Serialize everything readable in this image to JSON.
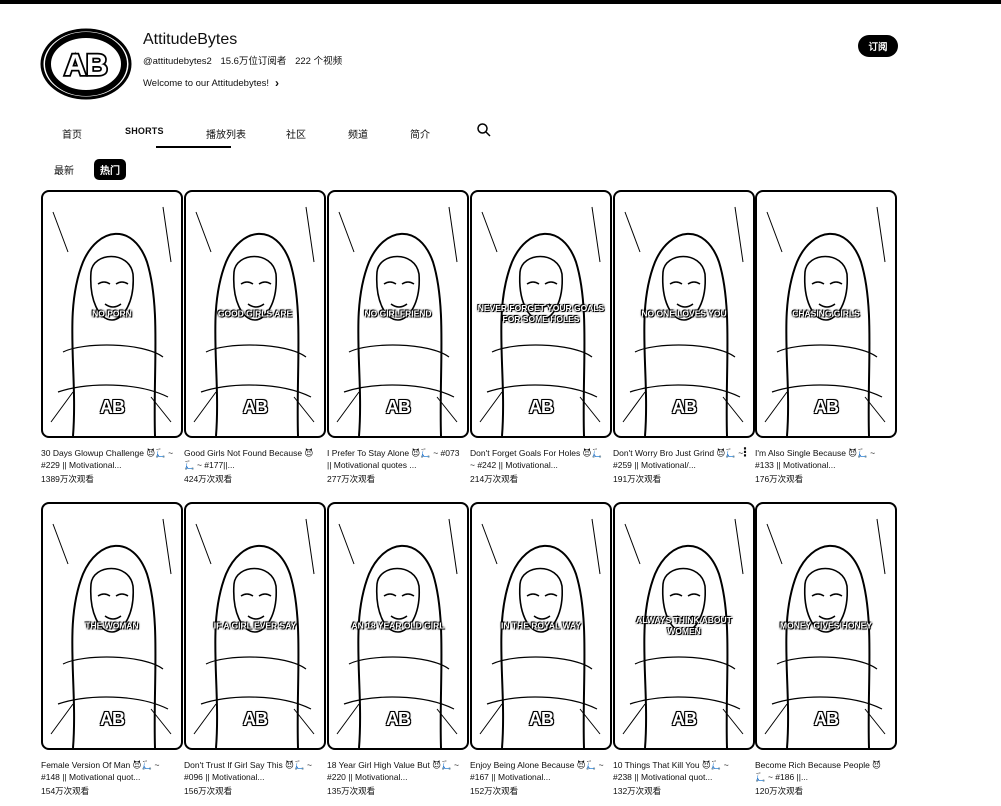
{
  "channel": {
    "name": "AttitudeBytes",
    "handle": "@attitudebytes2",
    "subscribers": "15.6万位订阅者",
    "video_count": "222 个视频",
    "description": "Welcome to our Attitudebytes!",
    "subscribe_label": "订阅",
    "avatar_text": "AB"
  },
  "tabs": [
    {
      "label": "首页"
    },
    {
      "label": "SHORTS"
    },
    {
      "label": "播放列表"
    },
    {
      "label": "社区"
    },
    {
      "label": "频道"
    },
    {
      "label": "简介"
    }
  ],
  "chips": [
    {
      "label": "最新"
    },
    {
      "label": "热门"
    }
  ],
  "shorts": [
    {
      "overlay": "NO PORN",
      "title": "30 Days Glowup Challenge 😈🛴 ~ #229 || Motivational...",
      "views": "1389万次观看"
    },
    {
      "overlay": "GOOD GIRLS ARE",
      "title": "Good Girls Not Found Because 😈🛴 ~ #177||...",
      "views": "424万次观看"
    },
    {
      "overlay": "NO GIRLFRIEND",
      "title": "I Prefer To Stay Alone 😈🛴 ~ #073 || Motivational quotes ...",
      "views": "277万次观看"
    },
    {
      "overlay": "NEVER FORGET YOUR GOALS FOR SOME HOLES",
      "title": "Don't Forget Goals For Holes 😈🛴 ~ #242 || Motivational...",
      "views": "214万次观看"
    },
    {
      "overlay": "NO ONE LOVES YOU",
      "title": "Don't Worry Bro Just Grind 😈🛴 ~ #259 || Motivational/...",
      "views": "191万次观看"
    },
    {
      "overlay": "CHASING GIRLS",
      "title": "I'm Also Single Because 😈🛴 ~ #133 || Motivational...",
      "views": "176万次观看"
    },
    {
      "overlay": "THE WOMAN",
      "title": "Female Version Of Man 😈🛴 ~ #148 || Motivational quot...",
      "views": "154万次观看"
    },
    {
      "overlay": "IF A GIRL EVER SAY",
      "title": "Don't Trust If Girl Say This 😈🛴 ~ #096 || Motivational...",
      "views": "156万次观看"
    },
    {
      "overlay": "AN 18 YEAR OLD GIRL",
      "title": "18 Year Girl High Value But 😈🛴 ~ #220 || Motivational...",
      "views": "135万次观看"
    },
    {
      "overlay": "IN THE ROYAL WAY",
      "title": "Enjoy Being Alone Because 😈🛴 ~ #167 || Motivational...",
      "views": "152万次观看"
    },
    {
      "overlay": "ALWAYS THINK ABOUT WOMEN",
      "title": "10 Things That Kill You 😈🛴 ~ #238 || Motivational quot...",
      "views": "132万次观看"
    },
    {
      "overlay": "MONEY GIVES HONEY",
      "title": "Become Rich Because People 😈🛴 ~ #186 ||...",
      "views": "120万次观看"
    }
  ],
  "watermark": "AB"
}
